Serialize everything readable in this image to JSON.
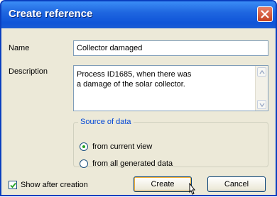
{
  "window": {
    "title": "Create reference"
  },
  "form": {
    "name_label": "Name",
    "name_value": "Collector damaged",
    "description_label": "Description",
    "description_lines": [
      "Process ID1685, when there was",
      "a damage of the solar collector."
    ]
  },
  "source": {
    "legend": "Source of data",
    "options": [
      {
        "label": "from current view",
        "selected": true
      },
      {
        "label": "from all generated data",
        "selected": false
      }
    ]
  },
  "footer": {
    "show_after_creation_label": "Show after creation",
    "show_after_creation_checked": true,
    "create_label": "Create",
    "cancel_label": "Cancel"
  },
  "icons": {
    "close": "close-icon",
    "scroll_up": "chevron-up-icon",
    "scroll_down": "chevron-down-icon",
    "cursor": "mouse-pointer-icon"
  }
}
